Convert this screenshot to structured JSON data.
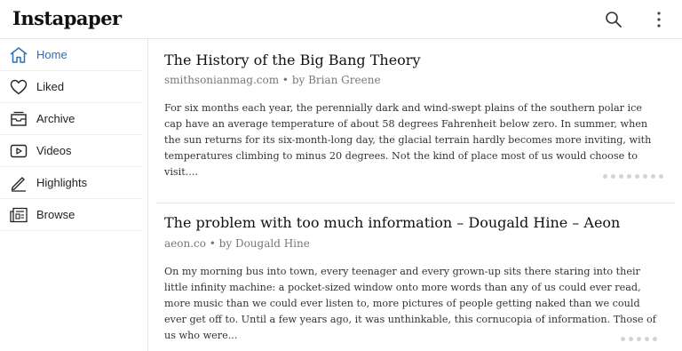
{
  "app": {
    "title": "Instapaper"
  },
  "icons": {
    "search": "search-icon",
    "more": "more-vertical-icon"
  },
  "sidebar": {
    "items": [
      {
        "label": "Home",
        "icon": "home-icon",
        "active": true
      },
      {
        "label": "Liked",
        "icon": "heart-icon",
        "active": false
      },
      {
        "label": "Archive",
        "icon": "archive-icon",
        "active": false
      },
      {
        "label": "Videos",
        "icon": "video-icon",
        "active": false
      },
      {
        "label": "Highlights",
        "icon": "pencil-icon",
        "active": false
      },
      {
        "label": "Browse",
        "icon": "browse-icon",
        "active": false
      }
    ]
  },
  "articles": [
    {
      "title": "The History of the Big Bang Theory",
      "meta": "smithsonianmag.com • by Brian Greene",
      "excerpt": "For six months each year, the perennially dark and wind-swept plains of the southern polar ice cap have an average temperature of about 58 degrees Fahrenheit below zero. In summer, when the sun returns for its six-month-long day, the glacial terrain hardly becomes more inviting, with temperatures climbing to minus 20 degrees. Not the kind of place most of us would choose to visit...."
    },
    {
      "title": "The problem with too much information – Dougald Hine – Aeon",
      "meta": "aeon.co • by Dougald Hine",
      "excerpt": "On my morning bus into town, every teenager and every grown-up sits there staring into their little infinity machine: a pocket-sized window onto more words than any of us could ever read, more music than we could ever listen to, more pictures of people getting naked than we could ever get off to. Until a few years ago, it was unthinkable, this cornucopia of information. Those of us who were..."
    }
  ],
  "colors": {
    "accent": "#2f6db5",
    "divider": "#e6e6e6",
    "meta_text": "#777777"
  }
}
